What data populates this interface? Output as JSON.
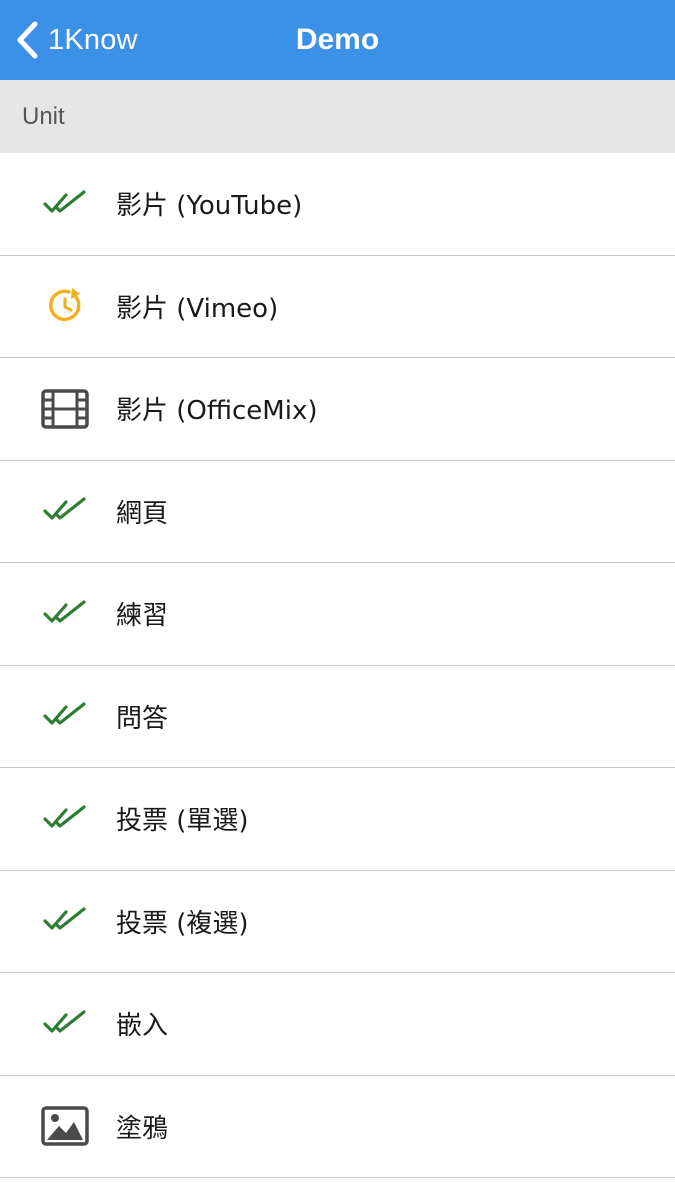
{
  "nav": {
    "back_label": "1Know",
    "title": "Demo"
  },
  "section": {
    "header": "Unit"
  },
  "items": [
    {
      "label": "影片 (YouTube)",
      "status": "completed"
    },
    {
      "label": "影片 (Vimeo)",
      "status": "in-progress"
    },
    {
      "label": "影片 (OfficeMix)",
      "status": "video"
    },
    {
      "label": "網頁",
      "status": "completed"
    },
    {
      "label": "練習",
      "status": "completed"
    },
    {
      "label": "問答",
      "status": "completed"
    },
    {
      "label": "投票 (單選)",
      "status": "completed"
    },
    {
      "label": "投票 (複選)",
      "status": "completed"
    },
    {
      "label": "嵌入",
      "status": "completed"
    },
    {
      "label": "塗鴉",
      "status": "image"
    }
  ],
  "colors": {
    "nav_background": "#3b91e8",
    "check_green": "#2e7d32",
    "progress_orange": "#f2b01e",
    "icon_gray": "#4a4a4a",
    "section_background": "#e6e6e6"
  },
  "icons": {
    "back": "chevron-left-icon",
    "completed": "double-check-icon",
    "in_progress": "clock-replay-icon",
    "video": "film-icon",
    "image": "image-icon"
  }
}
